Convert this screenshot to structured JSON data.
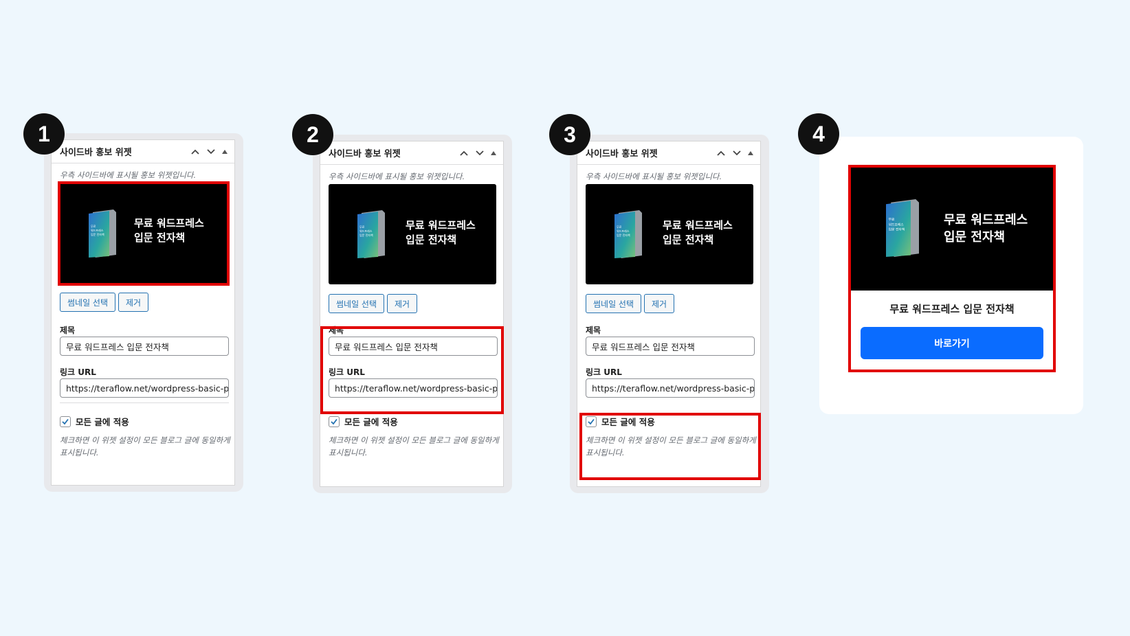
{
  "panels": [
    {
      "step": "1",
      "title": "사이드바 홍보 위젯",
      "description": "우측 사이드바에 표시될 홍보 위젯입니다.",
      "thumbnail_text_line1": "무료 워드프레스",
      "thumbnail_text_line2": "입문 전자책",
      "book_cover_lines": [
        "무료",
        "워드프레스",
        "입문 전자책"
      ],
      "select_thumbnail_label": "썸네일 선택",
      "remove_label": "제거",
      "title_label": "제목",
      "title_value": "무료 워드프레스 입문 전자책",
      "url_label": "링크 URL",
      "url_value": "https://teraflow.net/wordpress-basic-p",
      "apply_all_label": "모든 글에 적용",
      "apply_all_checked": true,
      "help_text": "체크하면 이 위젯 설정이 모든 블로그 글에 동일하게 표시됩니다.",
      "highlight": "thumbnail"
    },
    {
      "step": "2",
      "title": "사이드바 홍보 위젯",
      "description": "우측 사이드바에 표시될 홍보 위젯입니다.",
      "thumbnail_text_line1": "무료 워드프레스",
      "thumbnail_text_line2": "입문 전자책",
      "book_cover_lines": [
        "무료",
        "워드프레스",
        "입문 전자책"
      ],
      "select_thumbnail_label": "썸네일 선택",
      "remove_label": "제거",
      "title_label": "제목",
      "title_value": "무료 워드프레스 입문 전자책",
      "url_label": "링크 URL",
      "url_value": "https://teraflow.net/wordpress-basic-p",
      "apply_all_label": "모든 글에 적용",
      "apply_all_checked": true,
      "help_text": "체크하면 이 위젯 설정이 모든 블로그 글에 동일하게 표시됩니다.",
      "highlight": "fields"
    },
    {
      "step": "3",
      "title": "사이드바 홍보 위젯",
      "description": "우측 사이드바에 표시될 홍보 위젯입니다.",
      "thumbnail_text_line1": "무료 워드프레스",
      "thumbnail_text_line2": "입문 전자책",
      "book_cover_lines": [
        "무료",
        "워드프레스",
        "입문 전자책"
      ],
      "select_thumbnail_label": "썸네일 선택",
      "remove_label": "제거",
      "title_label": "제목",
      "title_value": "무료 워드프레스 입문 전자책",
      "url_label": "링크 URL",
      "url_value": "https://teraflow.net/wordpress-basic-p",
      "apply_all_label": "모든 글에 적용",
      "apply_all_checked": true,
      "help_text": "체크하면 이 위젯 설정이 모든 블로그 글에 동일하게 표시됩니다.",
      "highlight": "apply_all"
    }
  ],
  "preview": {
    "step": "4",
    "image_text_line1": "무료 워드프레스",
    "image_text_line2": "입문 전자책",
    "book_cover_lines": [
      "무료",
      "워드프레스",
      "입문 전자책"
    ],
    "title": "무료 워드프레스 입문 전자책",
    "button_label": "바로가기"
  },
  "colors": {
    "background": "#eef7fd",
    "highlight": "#e10000",
    "button_blue": "#0a6cff",
    "wp_blue": "#2271b1"
  }
}
